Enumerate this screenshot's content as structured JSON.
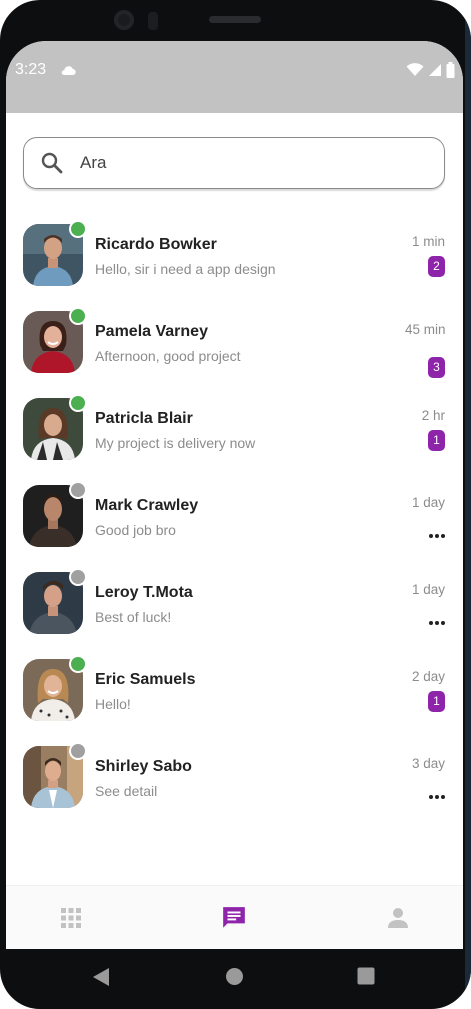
{
  "colors": {
    "accent": "#8e24aa",
    "online": "#4caf50",
    "offline": "#a0a0a0",
    "status_bar": "#c2c2c2",
    "inactive_icon": "#c2c2c2"
  },
  "status_bar": {
    "time": "3:23",
    "icons": [
      "cloud-icon",
      "wifi-icon",
      "signal-icon",
      "battery-icon"
    ]
  },
  "search": {
    "value": "Ara",
    "icon": "search-icon"
  },
  "chats": [
    {
      "name": "Ricardo Bowker",
      "preview": "Hello, sir i need a app design",
      "time": "1 min",
      "unread": "2",
      "online": true
    },
    {
      "name": "Pamela Varney",
      "preview": "Afternoon, good project",
      "time": "45 min",
      "unread": "3",
      "online": true
    },
    {
      "name": "Patricla Blair",
      "preview": "My project is delivery now",
      "time": "2 hr",
      "unread": "1",
      "online": true
    },
    {
      "name": "Mark Crawley",
      "preview": "Good job bro",
      "time": "1 day",
      "unread": null,
      "online": false
    },
    {
      "name": "Leroy T.Mota",
      "preview": "Best of luck!",
      "time": "1 day",
      "unread": null,
      "online": false
    },
    {
      "name": "Eric Samuels",
      "preview": "Hello!",
      "time": "2 day",
      "unread": "1",
      "online": true
    },
    {
      "name": "Shirley Sabo",
      "preview": "See detail",
      "time": "3 day",
      "unread": null,
      "online": false
    }
  ],
  "bottom_nav": {
    "items": [
      "apps-grid-icon",
      "chat-icon",
      "person-icon"
    ],
    "active": "chat-icon"
  },
  "system_nav": [
    "back-icon",
    "home-icon",
    "recents-icon"
  ]
}
